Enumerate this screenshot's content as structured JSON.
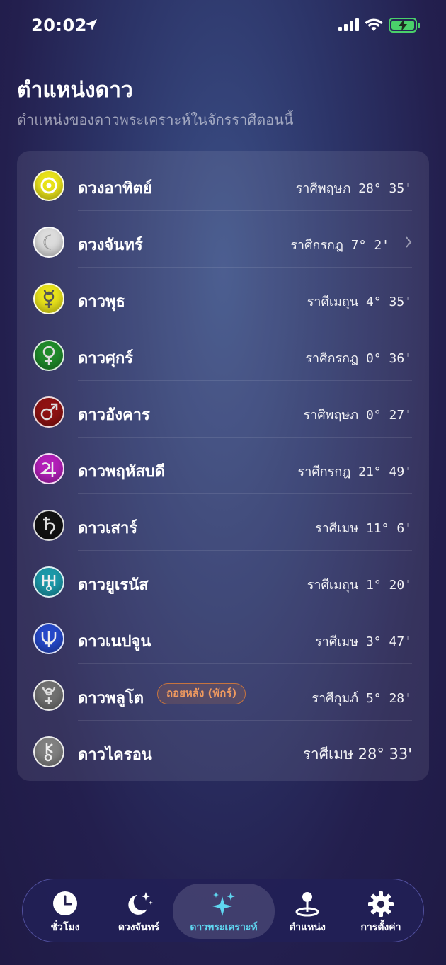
{
  "status_bar": {
    "time": "20:02"
  },
  "header": {
    "title": "ตำแหน่งดาว",
    "subtitle": "ตำแหน่งของดาวพระเคราะห์ในจักรราศีตอนนี้"
  },
  "planets": [
    {
      "name": "ดวงอาทิตย์",
      "position": "ราศีพฤษภ 28° 35'",
      "icon": "sun-icon",
      "color": "#e8e21a"
    },
    {
      "name": "ดวงจันทร์",
      "position": "ราศีกรกฎ 7° 2'",
      "icon": "moon-icon",
      "color": "#d9d9d9"
    },
    {
      "name": "ดาวพุธ",
      "position": "ราศีเมถุน 4° 35'",
      "icon": "mercury-icon",
      "color": "#e8e21a"
    },
    {
      "name": "ดาวศุกร์",
      "position": "ราศีกรกฎ 0° 36'",
      "icon": "venus-icon",
      "color": "#1f8a2a"
    },
    {
      "name": "ดาวอังคาร",
      "position": "ราศีพฤษภ 0° 27'",
      "icon": "mars-icon",
      "color": "#8e1212"
    },
    {
      "name": "ดาวพฤหัสบดี",
      "position": "ราศีกรกฎ 21° 49'",
      "icon": "jupiter-icon",
      "color": "#b21fb8"
    },
    {
      "name": "ดาวเสาร์",
      "position": "ราศีเมษ 11° 6'",
      "icon": "saturn-icon",
      "color": "#121212"
    },
    {
      "name": "ดาวยูเรนัส",
      "position": "ราศีเมถุน 1° 20'",
      "icon": "uranus-icon",
      "color": "#1c98a8"
    },
    {
      "name": "ดาวเนปจูน",
      "position": "ราศีเมษ 3° 47'",
      "icon": "neptune-icon",
      "color": "#2548c8"
    },
    {
      "name": "ดาวพลูโต",
      "position": "ราศีกุมภ์ 5° 28'",
      "icon": "pluto-icon",
      "color": "#707070",
      "badge": "ถอยหลัง (พักร์)"
    },
    {
      "name": "ดาวไครอน",
      "position": "ราศีเมษ 28° 33'",
      "icon": "chiron-icon",
      "color": "#808080"
    }
  ],
  "tab_bar": {
    "tabs": [
      {
        "label": "ชั่วโมง",
        "icon": "clock-icon"
      },
      {
        "label": "ดวงจันทร์",
        "icon": "moon-stars-icon"
      },
      {
        "label": "ดาวพระเคราะห์",
        "icon": "sparkles-icon",
        "active": true
      },
      {
        "label": "ตำแหน่ง",
        "icon": "map-pin-icon"
      },
      {
        "label": "การตั้งค่า",
        "icon": "gear-icon"
      }
    ]
  },
  "colors": {
    "accent": "#5fd6f0",
    "retrograde": "#f09a5f",
    "battery": "#4ad06a"
  }
}
